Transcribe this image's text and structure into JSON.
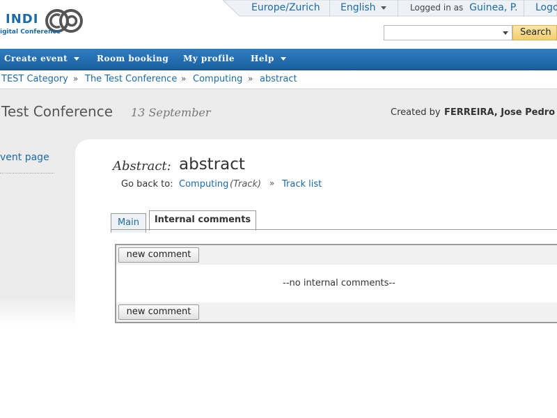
{
  "logo": {
    "text": "INDI",
    "subtitle": "igital Conference"
  },
  "topbar": {
    "timezone": "Europe/Zurich",
    "language": "English",
    "logged_in_label": "Logged in as",
    "user": "Guinea, P.",
    "logout": "Logo"
  },
  "search": {
    "value": "",
    "button": "Search"
  },
  "nav": {
    "items": [
      {
        "label": "Create event",
        "dropdown": true
      },
      {
        "label": "Room booking",
        "dropdown": false
      },
      {
        "label": "My profile",
        "dropdown": false
      },
      {
        "label": "Help",
        "dropdown": true
      }
    ]
  },
  "breadcrumb": {
    "items": [
      "TEST Category",
      "The Test Conference",
      "Computing",
      "abstract"
    ],
    "separator": "»"
  },
  "conference": {
    "title": "Test Conference",
    "date": "13 September",
    "created_label": "Created by",
    "creator": "FERREIRA, Jose Pedro"
  },
  "sidebar": {
    "event_page": "vent page"
  },
  "abstract": {
    "label": "Abstract:",
    "title": "abstract",
    "go_back_label": "Go back to:",
    "track_link": "Computing",
    "track_suffix": "(Track)",
    "track_list": "Track list",
    "separator": "»"
  },
  "tabs": [
    {
      "label": "Main",
      "active": false
    },
    {
      "label": "Internal comments",
      "active": true
    }
  ],
  "comments": {
    "new_button": "new comment",
    "empty_text": "--no internal comments--"
  },
  "colors": {
    "link": "#1b6aa8",
    "nav": "#1f66a6",
    "search_button": "#f1cd6e"
  }
}
